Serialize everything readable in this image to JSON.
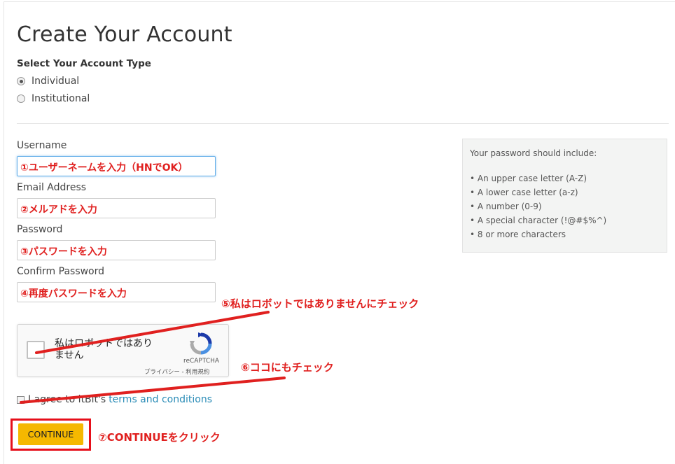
{
  "page": {
    "title": "Create Your Account",
    "account_type_label": "Select Your Account Type",
    "account_types": [
      {
        "label": "Individual",
        "selected": true
      },
      {
        "label": "Institutional",
        "selected": false
      }
    ]
  },
  "form": {
    "username_label": "Username",
    "username_value": "①ユーザーネームを入力（HNでOK）",
    "email_label": "Email Address",
    "email_value": "②メルアドを入力",
    "password_label": "Password",
    "password_value": "③パスワードを入力",
    "confirm_label": "Confirm Password",
    "confirm_value": "④再度パスワードを入力"
  },
  "password_hint": {
    "title": "Your password should include:",
    "items": [
      "An upper case letter (A-Z)",
      "A lower case letter (a-z)",
      "A number (0-9)",
      "A special character (!@#$%^)",
      "8 or more characters"
    ]
  },
  "captcha": {
    "label": "私はロボットではありません",
    "brand": "reCAPTCHA",
    "links": "プライバシー - 利用規約"
  },
  "agree": {
    "text": "I agree to itBit's",
    "link": "terms and conditions"
  },
  "continue_label": "CONTINUE",
  "annotations": {
    "robot": "⑤私はロボットではありませんにチェック",
    "terms": "⑥ココにもチェック",
    "continue": "⑦CONTINUEをクリック"
  },
  "colors": {
    "annotation_red": "#e0201f",
    "button_yellow": "#f5b800",
    "link_blue": "#2a8cb7",
    "focus_blue": "#66afe9"
  }
}
